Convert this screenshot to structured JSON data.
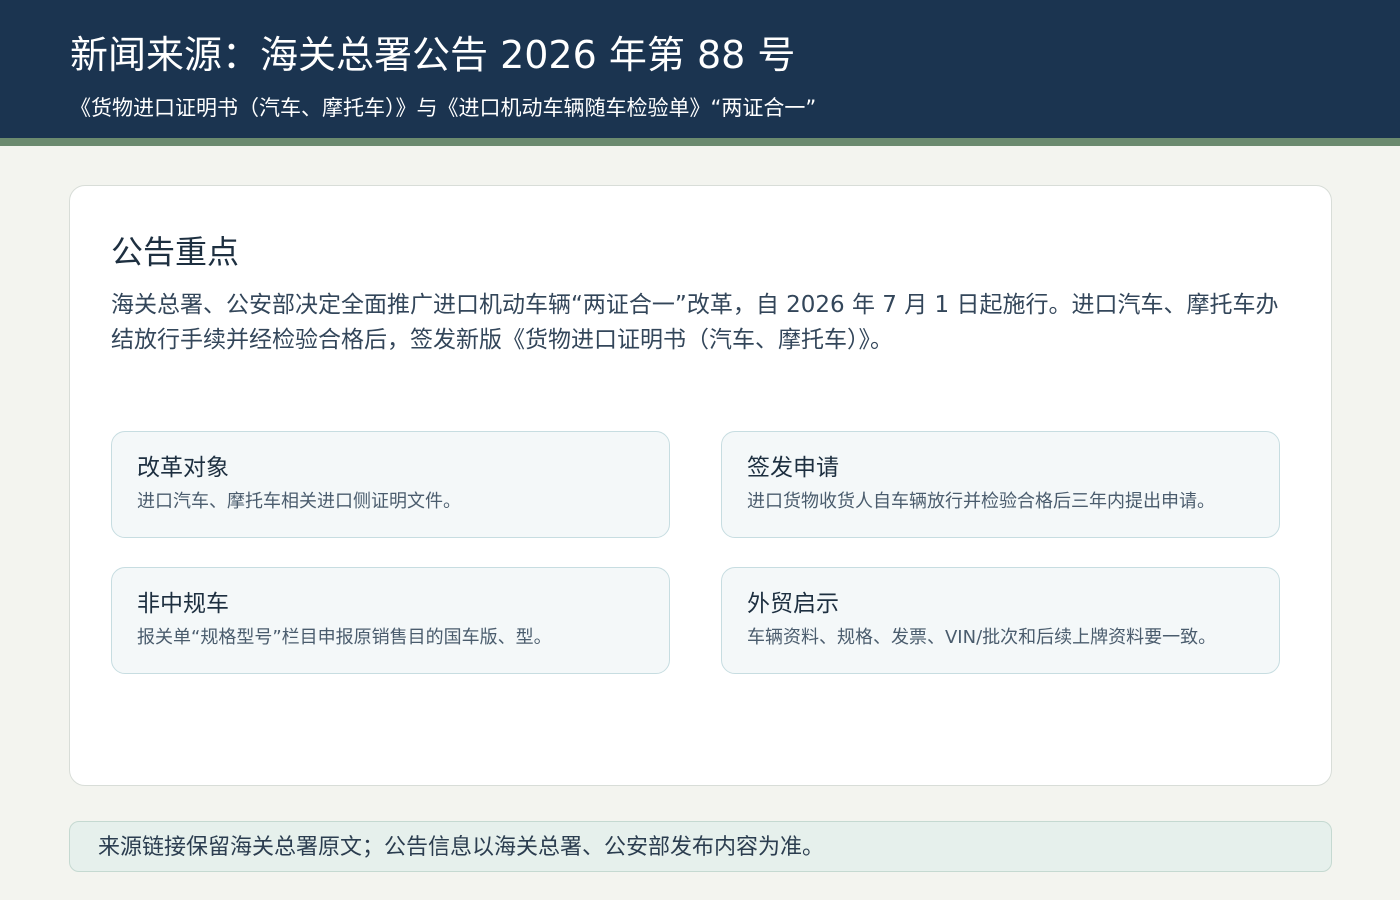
{
  "header": {
    "title": "新闻来源：海关总署公告 2026 年第 88 号",
    "subtitle": "《货物进口证明书（汽车、摩托车）》与《进口机动车辆随车检验单》“两证合一”"
  },
  "main": {
    "section_title": "公告重点",
    "section_body": "海关总署、公安部决定全面推广进口机动车辆“两证合一”改革，自 2026 年 7 月 1 日起施行。进口汽车、摩托车办结放行手续并经检验合格后，签发新版《货物进口证明书（汽车、摩托车）》。",
    "cards": [
      {
        "title": "改革对象",
        "desc": "进口汽车、摩托车相关进口侧证明文件。"
      },
      {
        "title": "签发申请",
        "desc": "进口货物收货人自车辆放行并检验合格后三年内提出申请。"
      },
      {
        "title": "非中规车",
        "desc": "报关单“规格型号”栏目申报原销售目的国车版、型。"
      },
      {
        "title": "外贸启示",
        "desc": "车辆资料、规格、发票、VIN/批次和后续上牌资料要一致。"
      }
    ]
  },
  "footer": {
    "note": "来源链接保留海关总署原文；公告信息以海关总署、公安部发布内容为准。"
  },
  "colors": {
    "header_bg": "#1b3450",
    "accent_stripe": "#6b8a6f",
    "page_bg": "#f3f4ef",
    "card_bg": "#f4f8f9",
    "footer_bg": "#e6f0ec"
  }
}
